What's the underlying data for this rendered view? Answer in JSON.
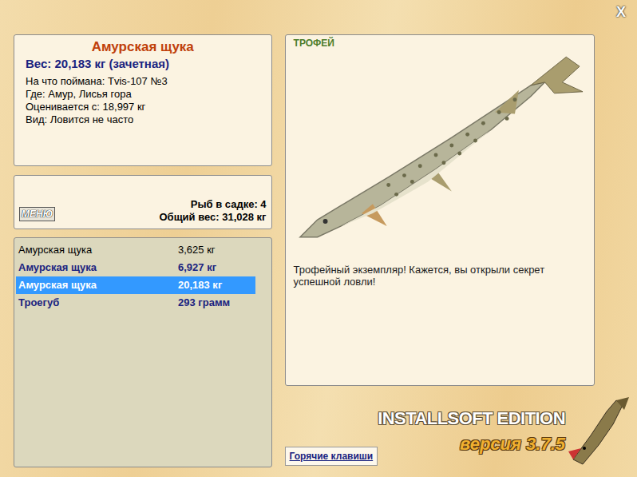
{
  "window": {
    "close": "X"
  },
  "fish_info": {
    "title": "Амурская щука",
    "weight": "Вес: 20,183 кг (зачетная)",
    "details": [
      "На что поймана: Tvis-107 №3",
      "Где: Амур, Лисья гора",
      "Оценивается с: 18,997 кг",
      "Вид: Ловится не часто"
    ]
  },
  "menu_button": "МЕНЮ",
  "keepnet": {
    "count": "Рыб в садке: 4",
    "total": "Общий вес: 31,028 кг"
  },
  "catch_list": [
    {
      "name": "Амурская щука",
      "weight": "3,625 кг",
      "bold": false,
      "selected": false
    },
    {
      "name": "Амурская щука",
      "weight": "6,927 кг",
      "bold": true,
      "selected": false
    },
    {
      "name": "Амурская щука",
      "weight": "20,183 кг",
      "bold": true,
      "selected": true
    },
    {
      "name": "Троегуб",
      "weight": "293 грамм",
      "bold": true,
      "selected": false
    }
  ],
  "trophy": {
    "badge": "ТРОФЕЙ",
    "message": "Трофейный экземпляр! Кажется, вы открыли секрет успешной ловли!"
  },
  "hotkeys_button": "Горячие клавиши",
  "brand": {
    "edition": "INSTALLSOFT EDITION",
    "version": "версия 3.7.5"
  }
}
